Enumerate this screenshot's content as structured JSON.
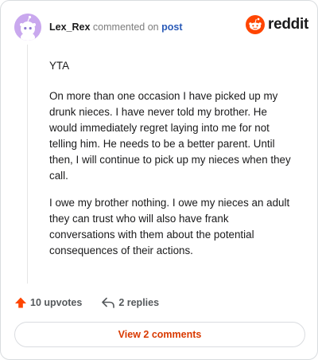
{
  "header": {
    "username": "Lex_Rex",
    "action_text": "commented on",
    "post_link": "post",
    "brand_wordmark": "reddit"
  },
  "comment": {
    "paragraphs": [
      "YTA",
      "On more than one occasion I have picked up my drunk nieces. I have never told my brother. He would immediately regret laying into me for not telling him. He needs to be a better parent. Until then, I will continue to pick up my nieces when they call.",
      "I owe my brother nothing. I owe my nieces an adult they can trust who will also have frank conversations with them about the potential consequences of their actions."
    ]
  },
  "actions": {
    "upvotes_label": "10 upvotes",
    "replies_label": "2 replies"
  },
  "footer": {
    "view_comments_label": "View 2 comments"
  },
  "colors": {
    "brand": "#ff4500",
    "upvote": "#ff4500",
    "link": "#2b5bb8",
    "view_button_text": "#d93900",
    "avatar_bg": "#c9a8ee"
  },
  "icons": {
    "avatar": "snoo-avatar-icon",
    "brand": "reddit-logo-icon",
    "upvote": "upvote-arrow-icon",
    "reply": "reply-arrow-icon"
  }
}
